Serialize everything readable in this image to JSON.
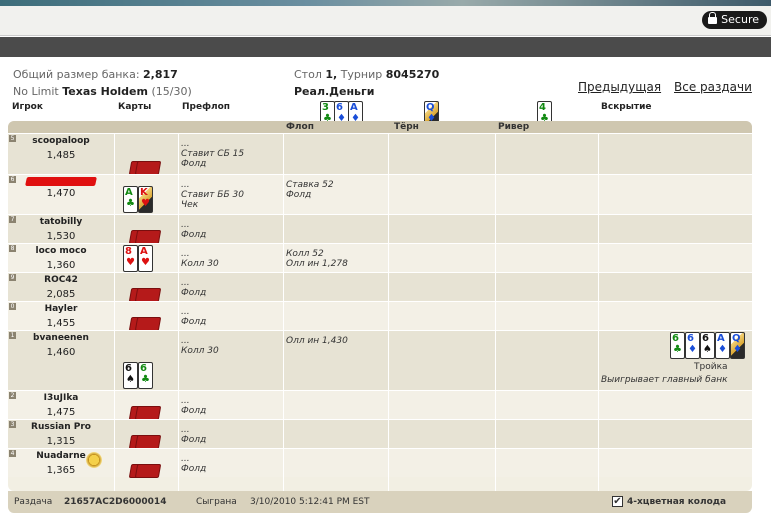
{
  "browser": {
    "secure_label": "Secure"
  },
  "hand_info": {
    "pot_label": "Общий размер банка:",
    "pot_value": "2,817",
    "game_prefix": "No Limit",
    "game_name": "Texas Holdem",
    "game_stakes": "(15/30)",
    "table_label": "Стол",
    "table_no": "1,",
    "tournament_label": "Турнир",
    "tournament_no": "8045270",
    "money_type": "Реал.Деньги"
  },
  "nav": {
    "prev": "Предыдущая",
    "all": "Все раздачи"
  },
  "columns": {
    "player": "Игрок",
    "cards": "Карты",
    "preflop": "Префлоп",
    "flop": "Флоп",
    "turn": "Тёрн",
    "river": "Ривер",
    "showdown": "Вскрытие"
  },
  "board": {
    "flop": [
      {
        "rank": "3",
        "suit": "♣",
        "color": "c"
      },
      {
        "rank": "6",
        "suit": "♦",
        "color": "d"
      },
      {
        "rank": "A",
        "suit": "♦",
        "color": "d"
      }
    ],
    "turn": [
      {
        "rank": "Q",
        "suit": "♦",
        "color": "d",
        "face": true
      }
    ],
    "river": [
      {
        "rank": "4",
        "suit": "♣",
        "color": "c"
      }
    ]
  },
  "players": [
    {
      "seat": "5",
      "name": "scoopaloop",
      "chips": "1,485",
      "preflop": [
        "...",
        "Ставит СБ 15",
        "Фолд"
      ],
      "flop": [],
      "cards": "facedown"
    },
    {
      "seat": "6",
      "name": "",
      "chips": "1,470",
      "preflop": [
        "...",
        "Ставит ББ 30",
        "Чек"
      ],
      "flop": [
        "Ставка 52",
        "Фолд"
      ],
      "cards": [
        {
          "rank": "A",
          "suit": "♣",
          "color": "c"
        },
        {
          "rank": "K",
          "suit": "♥",
          "color": "h",
          "face": true
        }
      ]
    },
    {
      "seat": "7",
      "name": "tatobilly",
      "chips": "1,530",
      "preflop": [
        "...",
        "Фолд"
      ],
      "flop": [],
      "cards": "facedown"
    },
    {
      "seat": "8",
      "name": "loco moco",
      "chips": "1,360",
      "preflop": [
        "...",
        "Колл 30"
      ],
      "flop": [
        "Колл 52",
        "Олл ин 1,278"
      ],
      "cards": [
        {
          "rank": "8",
          "suit": "♥",
          "color": "h"
        },
        {
          "rank": "A",
          "suit": "♥",
          "color": "h"
        }
      ]
    },
    {
      "seat": "9",
      "name": "ROC42",
      "chips": "2,085",
      "preflop": [
        "...",
        "Фолд"
      ],
      "flop": [],
      "cards": "facedown"
    },
    {
      "seat": "0",
      "name": "Hayler",
      "chips": "1,455",
      "preflop": [
        "...",
        "Фолд"
      ],
      "flop": [],
      "cards": "facedown"
    },
    {
      "seat": "1",
      "name": "bvaneenen",
      "chips": "1,460",
      "preflop": [
        "...",
        "Колл 30"
      ],
      "flop": [
        "Олл ин 1,430"
      ],
      "cards": [
        {
          "rank": "6",
          "suit": "♠",
          "color": "s"
        },
        {
          "rank": "6",
          "suit": "♣",
          "color": "c"
        }
      ],
      "showdown": {
        "hand": [
          {
            "rank": "6",
            "suit": "♣",
            "color": "c"
          },
          {
            "rank": "6",
            "suit": "♦",
            "color": "d"
          },
          {
            "rank": "6",
            "suit": "♠",
            "color": "s"
          },
          {
            "rank": "A",
            "suit": "♦",
            "color": "d"
          },
          {
            "rank": "Q",
            "suit": "♦",
            "color": "d",
            "face": true
          }
        ],
        "result": "Тройка",
        "note": "Выигрывает главный банк"
      }
    },
    {
      "seat": "2",
      "name": "I3uJIka",
      "chips": "1,475",
      "preflop": [
        "...",
        "Фолд"
      ],
      "flop": [],
      "cards": "facedown"
    },
    {
      "seat": "3",
      "name": "Russian Pro",
      "chips": "1,315",
      "preflop": [
        "...",
        "Фолд"
      ],
      "flop": [],
      "cards": "facedown"
    },
    {
      "seat": "4",
      "name": "Nuadarne",
      "chips": "1,365",
      "preflop": [
        "...",
        "Фолд"
      ],
      "flop": [],
      "cards": "facedown",
      "dealer": true
    }
  ],
  "footer": {
    "hand_label": "Раздача",
    "hand_id": "21657AC2D6000014",
    "played_label": "Сыграна",
    "played_time": "3/10/2010 5:12:41 PM EST",
    "four_color_label": "4-хцветная колода",
    "four_color_checked": true
  }
}
